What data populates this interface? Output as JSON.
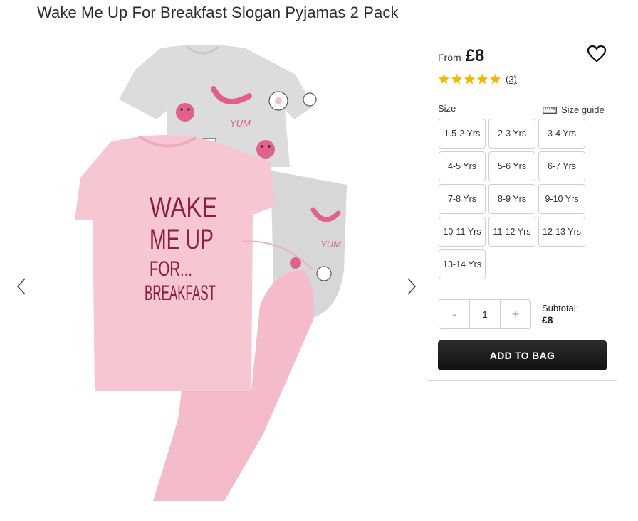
{
  "product": {
    "title": "Wake Me Up For Breakfast Slogan Pyjamas 2 Pack",
    "image_alt": "Pink and grey pyjamas 2 pack"
  },
  "gallery": {
    "prev_icon": "chevron-left-icon",
    "next_icon": "chevron-right-icon",
    "slogan_lines": [
      "WAKE",
      "ME UP",
      "FOR...",
      "BREAKFAST"
    ],
    "pattern_word": "YUM"
  },
  "panel": {
    "from_label": "From",
    "price": "£8",
    "wishlist_icon": "heart-icon",
    "rating": 5,
    "review_count": "(3)",
    "size_label": "Size",
    "size_guide_label": "Size guide",
    "sizes": [
      "1.5-2 Yrs",
      "2-3 Yrs",
      "3-4 Yrs",
      "4-5 Yrs",
      "5-6 Yrs",
      "6-7 Yrs",
      "7-8 Yrs",
      "8-9 Yrs",
      "9-10 Yrs",
      "10-11 Yrs",
      "11-12 Yrs",
      "12-13 Yrs",
      "13-14 Yrs"
    ],
    "quantity": {
      "minus": "-",
      "value": "1",
      "plus": "+"
    },
    "subtotal_label": "Subtotal:",
    "subtotal_value": "£8",
    "add_to_bag": "ADD TO BAG"
  },
  "colors": {
    "star": "#f5b800",
    "button_bg": "#1a1a1a",
    "pink": "#f7c6d3",
    "grey": "#d9d9d9",
    "slogan": "#8c1f3e"
  }
}
